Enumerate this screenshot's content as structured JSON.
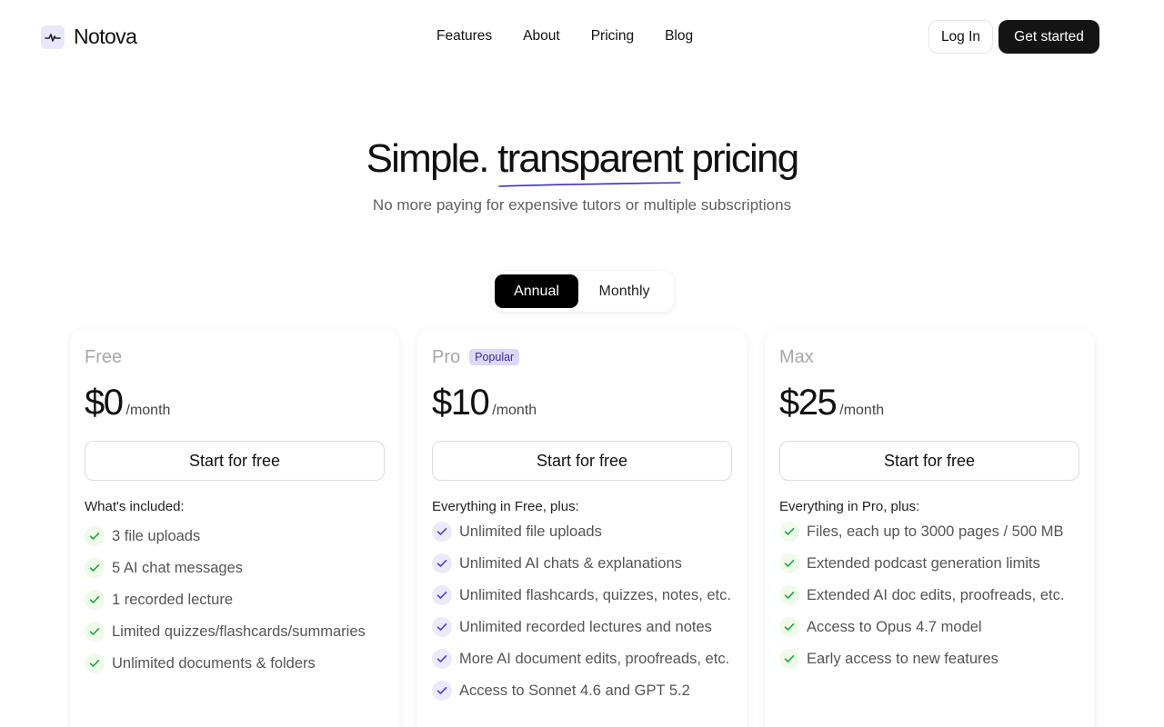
{
  "brand": {
    "name": "Notova"
  },
  "nav": {
    "links": [
      "Features",
      "About",
      "Pricing",
      "Blog"
    ],
    "login_label": "Log In",
    "cta_label": "Get started"
  },
  "hero": {
    "title_before": "Simple. ",
    "title_highlight": "transparent",
    "title_after": " pricing",
    "subtitle": "No more paying for expensive tutors or multiple subscriptions",
    "underline_color": "#3b32c4"
  },
  "billing_toggle": {
    "active": "Annual",
    "inactive": "Monthly"
  },
  "colors": {
    "check_green": "#22a33c",
    "check_purple": "#4a3fc8",
    "dark": "#141414"
  },
  "plans": [
    {
      "name": "Free",
      "badge": "",
      "price": "$0",
      "period": "/month",
      "cta": "Start for free",
      "included_label": "What's included:",
      "check_style": "green",
      "features": [
        "3 file uploads",
        "5 AI chat messages",
        "1 recorded lecture",
        "Limited quizzes/flashcards/summaries",
        "Unlimited documents & folders"
      ]
    },
    {
      "name": "Pro",
      "badge": "Popular",
      "price": "$10",
      "period": "/month",
      "cta": "Start for free",
      "included_label": "Everything in Free, plus:",
      "check_style": "purple",
      "features": [
        "Unlimited file uploads",
        "Unlimited AI chats & explanations",
        "Unlimited flashcards, quizzes, notes, etc.",
        "Unlimited recorded lectures and notes",
        "More AI document edits, proofreads, etc.",
        "Access to Sonnet 4.6 and GPT 5.2"
      ]
    },
    {
      "name": "Max",
      "badge": "",
      "price": "$25",
      "period": "/month",
      "cta": "Start for free",
      "included_label": "Everything in Pro, plus:",
      "check_style": "green",
      "features": [
        "Files, each up to 3000 pages / 500 MB",
        "Extended podcast generation limits",
        "Extended AI doc edits, proofreads, etc.",
        "Access to Opus 4.7 model",
        "Early access to new features"
      ]
    }
  ]
}
